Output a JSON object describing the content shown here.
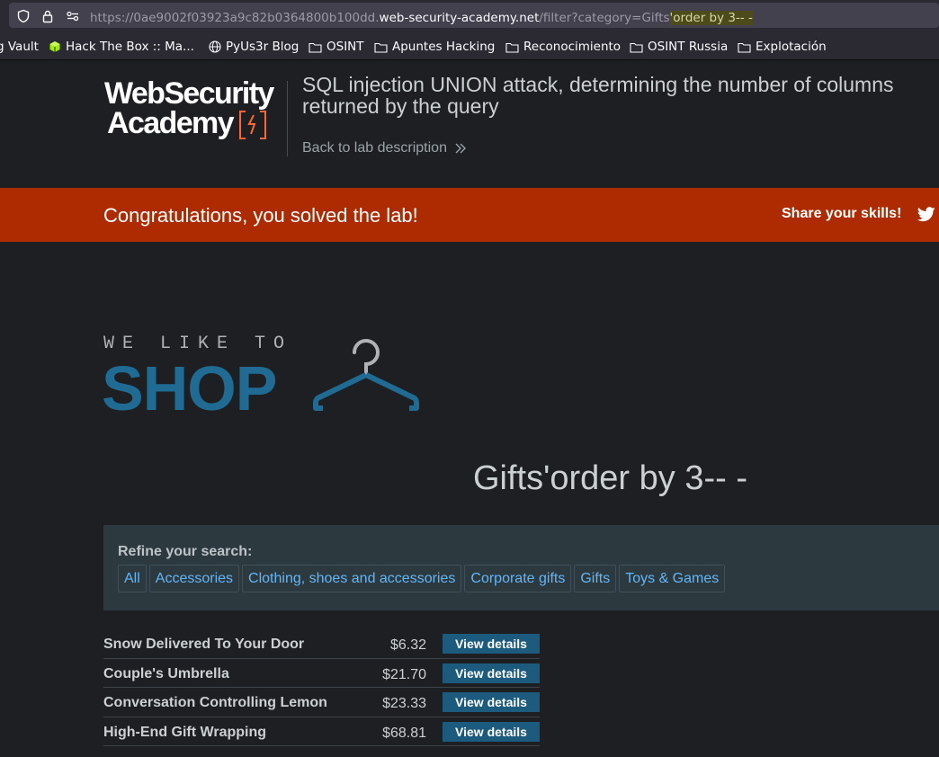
{
  "browser": {
    "url_prefix": "https://0ae9002f03923a9c82b0364800b100dd.",
    "url_host": "web-security-academy.net",
    "url_path": "/filter?category=Gifts",
    "url_highlight": "'order by 3-- -",
    "bookmarks": [
      {
        "label": "g Vault",
        "icon": "none"
      },
      {
        "label": "Hack The Box :: Ma...",
        "icon": "htb-cube-icon"
      },
      {
        "label": "PyUs3r Blog",
        "icon": "globe-icon"
      },
      {
        "label": "OSINT",
        "icon": "folder-icon"
      },
      {
        "label": "Apuntes Hacking",
        "icon": "folder-icon"
      },
      {
        "label": "Reconocimiento",
        "icon": "folder-icon"
      },
      {
        "label": "OSINT Russia",
        "icon": "folder-icon"
      },
      {
        "label": "Explotación",
        "icon": "folder-icon"
      }
    ]
  },
  "header": {
    "logo_line1": "WebSecurity",
    "logo_line2": "Academy",
    "lab_title": "SQL injection UNION attack, determining the number of columns returned by the query",
    "back_link": "Back to lab description"
  },
  "banner": {
    "message": "Congratulations, you solved the lab!",
    "share": "Share your skills!"
  },
  "shop": {
    "tagline": "WE LIKE TO",
    "name": "SHOP"
  },
  "category_title": "Gifts'order by 3-- -",
  "filter": {
    "label": "Refine your search:",
    "categories": [
      "All",
      "Accessories",
      "Clothing, shoes and accessories",
      "Corporate gifts",
      "Gifts",
      "Toys & Games"
    ]
  },
  "products": [
    {
      "name": "Snow Delivered To Your Door",
      "price": "$6.32",
      "button": "View details"
    },
    {
      "name": "Couple's Umbrella",
      "price": "$21.70",
      "button": "View details"
    },
    {
      "name": "Conversation Controlling Lemon",
      "price": "$23.33",
      "button": "View details"
    },
    {
      "name": "High-End Gift Wrapping",
      "price": "$68.81",
      "button": "View details"
    }
  ],
  "colors": {
    "banner": "#ae2a00",
    "shop_blue": "#1f6b93",
    "link_blue": "#64b5f6",
    "button_blue": "#1c5a7e"
  }
}
